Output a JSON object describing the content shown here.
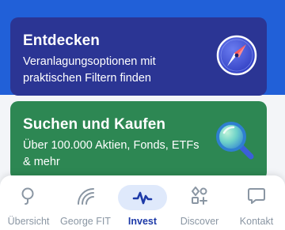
{
  "cards": [
    {
      "title": "Entdecken",
      "subtitle": "Veranlagungsoptionen mit praktischen Filtern finden",
      "icon": "compass-icon",
      "color": "#2b3594"
    },
    {
      "title": "Suchen und Kaufen",
      "subtitle": "Über 100.000 Aktien, Fonds, ETFs & mehr",
      "icon": "magnifier-icon",
      "color": "#2d8753"
    }
  ],
  "tabs": [
    {
      "label": "Übersicht",
      "icon": "overview-icon",
      "active": false
    },
    {
      "label": "George FIT",
      "icon": "signal-icon",
      "active": false
    },
    {
      "label": "Invest",
      "icon": "chart-pulse-icon",
      "active": true
    },
    {
      "label": "Discover",
      "icon": "discover-grid-icon",
      "active": false
    },
    {
      "label": "Kontakt",
      "icon": "chat-bubble-icon",
      "active": false
    }
  ],
  "colors": {
    "accent": "#1d3aa8",
    "active_pill": "#dfe9fb",
    "inactive": "#8a96a3"
  }
}
